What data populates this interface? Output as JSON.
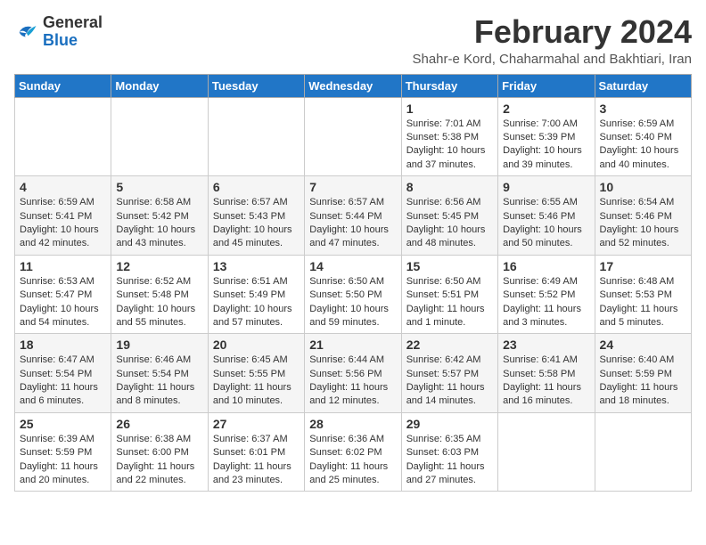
{
  "logo": {
    "line1": "General",
    "line2": "Blue"
  },
  "title": "February 2024",
  "subtitle": "Shahr-e Kord, Chaharmahal and Bakhtiari, Iran",
  "weekdays": [
    "Sunday",
    "Monday",
    "Tuesday",
    "Wednesday",
    "Thursday",
    "Friday",
    "Saturday"
  ],
  "weeks": [
    [
      {
        "day": "",
        "info": ""
      },
      {
        "day": "",
        "info": ""
      },
      {
        "day": "",
        "info": ""
      },
      {
        "day": "",
        "info": ""
      },
      {
        "day": "1",
        "info": "Sunrise: 7:01 AM\nSunset: 5:38 PM\nDaylight: 10 hours\nand 37 minutes."
      },
      {
        "day": "2",
        "info": "Sunrise: 7:00 AM\nSunset: 5:39 PM\nDaylight: 10 hours\nand 39 minutes."
      },
      {
        "day": "3",
        "info": "Sunrise: 6:59 AM\nSunset: 5:40 PM\nDaylight: 10 hours\nand 40 minutes."
      }
    ],
    [
      {
        "day": "4",
        "info": "Sunrise: 6:59 AM\nSunset: 5:41 PM\nDaylight: 10 hours\nand 42 minutes."
      },
      {
        "day": "5",
        "info": "Sunrise: 6:58 AM\nSunset: 5:42 PM\nDaylight: 10 hours\nand 43 minutes."
      },
      {
        "day": "6",
        "info": "Sunrise: 6:57 AM\nSunset: 5:43 PM\nDaylight: 10 hours\nand 45 minutes."
      },
      {
        "day": "7",
        "info": "Sunrise: 6:57 AM\nSunset: 5:44 PM\nDaylight: 10 hours\nand 47 minutes."
      },
      {
        "day": "8",
        "info": "Sunrise: 6:56 AM\nSunset: 5:45 PM\nDaylight: 10 hours\nand 48 minutes."
      },
      {
        "day": "9",
        "info": "Sunrise: 6:55 AM\nSunset: 5:46 PM\nDaylight: 10 hours\nand 50 minutes."
      },
      {
        "day": "10",
        "info": "Sunrise: 6:54 AM\nSunset: 5:46 PM\nDaylight: 10 hours\nand 52 minutes."
      }
    ],
    [
      {
        "day": "11",
        "info": "Sunrise: 6:53 AM\nSunset: 5:47 PM\nDaylight: 10 hours\nand 54 minutes."
      },
      {
        "day": "12",
        "info": "Sunrise: 6:52 AM\nSunset: 5:48 PM\nDaylight: 10 hours\nand 55 minutes."
      },
      {
        "day": "13",
        "info": "Sunrise: 6:51 AM\nSunset: 5:49 PM\nDaylight: 10 hours\nand 57 minutes."
      },
      {
        "day": "14",
        "info": "Sunrise: 6:50 AM\nSunset: 5:50 PM\nDaylight: 10 hours\nand 59 minutes."
      },
      {
        "day": "15",
        "info": "Sunrise: 6:50 AM\nSunset: 5:51 PM\nDaylight: 11 hours\nand 1 minute."
      },
      {
        "day": "16",
        "info": "Sunrise: 6:49 AM\nSunset: 5:52 PM\nDaylight: 11 hours\nand 3 minutes."
      },
      {
        "day": "17",
        "info": "Sunrise: 6:48 AM\nSunset: 5:53 PM\nDaylight: 11 hours\nand 5 minutes."
      }
    ],
    [
      {
        "day": "18",
        "info": "Sunrise: 6:47 AM\nSunset: 5:54 PM\nDaylight: 11 hours\nand 6 minutes."
      },
      {
        "day": "19",
        "info": "Sunrise: 6:46 AM\nSunset: 5:54 PM\nDaylight: 11 hours\nand 8 minutes."
      },
      {
        "day": "20",
        "info": "Sunrise: 6:45 AM\nSunset: 5:55 PM\nDaylight: 11 hours\nand 10 minutes."
      },
      {
        "day": "21",
        "info": "Sunrise: 6:44 AM\nSunset: 5:56 PM\nDaylight: 11 hours\nand 12 minutes."
      },
      {
        "day": "22",
        "info": "Sunrise: 6:42 AM\nSunset: 5:57 PM\nDaylight: 11 hours\nand 14 minutes."
      },
      {
        "day": "23",
        "info": "Sunrise: 6:41 AM\nSunset: 5:58 PM\nDaylight: 11 hours\nand 16 minutes."
      },
      {
        "day": "24",
        "info": "Sunrise: 6:40 AM\nSunset: 5:59 PM\nDaylight: 11 hours\nand 18 minutes."
      }
    ],
    [
      {
        "day": "25",
        "info": "Sunrise: 6:39 AM\nSunset: 5:59 PM\nDaylight: 11 hours\nand 20 minutes."
      },
      {
        "day": "26",
        "info": "Sunrise: 6:38 AM\nSunset: 6:00 PM\nDaylight: 11 hours\nand 22 minutes."
      },
      {
        "day": "27",
        "info": "Sunrise: 6:37 AM\nSunset: 6:01 PM\nDaylight: 11 hours\nand 23 minutes."
      },
      {
        "day": "28",
        "info": "Sunrise: 6:36 AM\nSunset: 6:02 PM\nDaylight: 11 hours\nand 25 minutes."
      },
      {
        "day": "29",
        "info": "Sunrise: 6:35 AM\nSunset: 6:03 PM\nDaylight: 11 hours\nand 27 minutes."
      },
      {
        "day": "",
        "info": ""
      },
      {
        "day": "",
        "info": ""
      }
    ]
  ]
}
